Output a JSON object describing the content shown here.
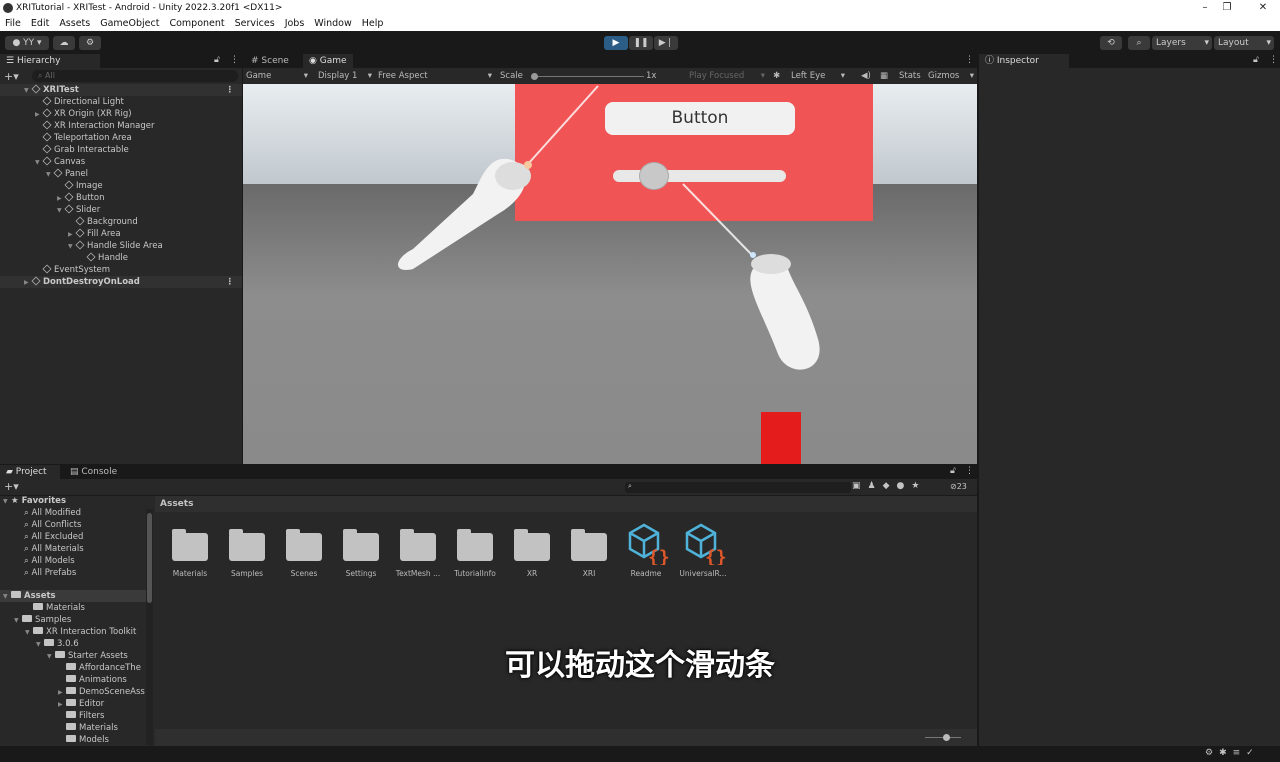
{
  "window": {
    "title": "XRITutorial - XRITest - Android - Unity 2022.3.20f1 <DX11>"
  },
  "menu": [
    "File",
    "Edit",
    "Assets",
    "GameObject",
    "Component",
    "Services",
    "Jobs",
    "Window",
    "Help"
  ],
  "toolbar": {
    "account": "YY",
    "layers": "Layers",
    "layout": "Layout"
  },
  "hierarchy": {
    "tab": "Hierarchy",
    "search_placeholder": "All",
    "items": [
      {
        "label": "XRITest",
        "depth": 0,
        "scene": true
      },
      {
        "label": "Directional Light",
        "depth": 1
      },
      {
        "label": "XR Origin (XR Rig)",
        "depth": 1,
        "collapsed": true
      },
      {
        "label": "XR Interaction Manager",
        "depth": 1
      },
      {
        "label": "Teleportation Area",
        "depth": 1
      },
      {
        "label": "Grab Interactable",
        "depth": 1
      },
      {
        "label": "Canvas",
        "depth": 1,
        "expanded": true
      },
      {
        "label": "Panel",
        "depth": 2,
        "expanded": true
      },
      {
        "label": "Image",
        "depth": 3
      },
      {
        "label": "Button",
        "depth": 3,
        "collapsed": true
      },
      {
        "label": "Slider",
        "depth": 3,
        "expanded": true
      },
      {
        "label": "Background",
        "depth": 4
      },
      {
        "label": "Fill Area",
        "depth": 4,
        "collapsed": true
      },
      {
        "label": "Handle Slide Area",
        "depth": 4,
        "expanded": true
      },
      {
        "label": "Handle",
        "depth": 5
      },
      {
        "label": "EventSystem",
        "depth": 1
      },
      {
        "label": "DontDestroyOnLoad",
        "depth": 0,
        "scene": true,
        "collapsed": true
      }
    ]
  },
  "game": {
    "tabs": [
      "Scene",
      "Game"
    ],
    "mode": "Game",
    "display": "Display 1",
    "aspect": "Free Aspect",
    "scale_label": "Scale",
    "scale": "1x",
    "play_focused": "Play Focused",
    "eye": "Left Eye",
    "stats": "Stats",
    "gizmos": "Gizmos",
    "ui_button": "Button",
    "slider_value": 0.25,
    "colors": {
      "panel": "#f05454",
      "cube": "#e51c1c"
    }
  },
  "inspector": {
    "tab": "Inspector"
  },
  "project": {
    "tabs": [
      "Project",
      "Console"
    ],
    "hidden_count": "23",
    "favorites": {
      "label": "Favorites",
      "items": [
        "All Modified",
        "All Conflicts",
        "All Excluded",
        "All Materials",
        "All Models",
        "All Prefabs"
      ]
    },
    "tree": [
      {
        "label": "Assets",
        "depth": 0,
        "open": true
      },
      {
        "label": "Materials",
        "depth": 1
      },
      {
        "label": "Samples",
        "depth": 1,
        "open": true
      },
      {
        "label": "XR Interaction Toolkit",
        "depth": 2,
        "open": true
      },
      {
        "label": "3.0.6",
        "depth": 3,
        "open": true
      },
      {
        "label": "Starter Assets",
        "depth": 4,
        "open": true
      },
      {
        "label": "AffordanceThe",
        "depth": 5
      },
      {
        "label": "Animations",
        "depth": 5
      },
      {
        "label": "DemoSceneAss",
        "depth": 5,
        "collapsed": true
      },
      {
        "label": "Editor",
        "depth": 5,
        "collapsed": true
      },
      {
        "label": "Filters",
        "depth": 5
      },
      {
        "label": "Materials",
        "depth": 5
      },
      {
        "label": "Models",
        "depth": 5
      }
    ],
    "breadcrumb": "Assets",
    "assets": [
      {
        "label": "Materials",
        "type": "folder"
      },
      {
        "label": "Samples",
        "type": "folder"
      },
      {
        "label": "Scenes",
        "type": "folder"
      },
      {
        "label": "Settings",
        "type": "folder"
      },
      {
        "label": "TextMesh ...",
        "type": "folder"
      },
      {
        "label": "TutorialInfo",
        "type": "folder"
      },
      {
        "label": "XR",
        "type": "folder"
      },
      {
        "label": "XRI",
        "type": "folder"
      },
      {
        "label": "Readme",
        "type": "script"
      },
      {
        "label": "UniversalR...",
        "type": "script"
      }
    ]
  },
  "subtitle": "可以拖动这个滑动条"
}
